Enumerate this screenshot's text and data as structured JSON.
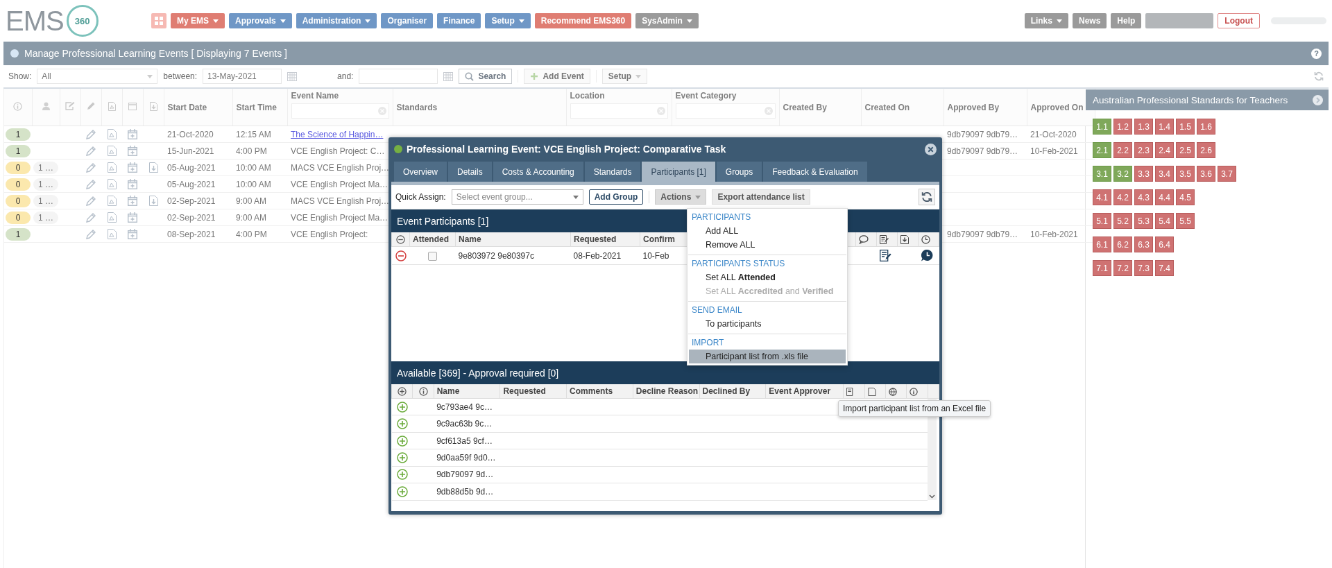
{
  "logo": {
    "wordmark": "EMS",
    "number": "360"
  },
  "nav": [
    {
      "label": "My EMS",
      "dropdown": true,
      "color": "#df7d72"
    },
    {
      "label": "Approvals",
      "dropdown": true,
      "color": "#6f97c6"
    },
    {
      "label": "Administration",
      "dropdown": true,
      "color": "#6f97c6"
    },
    {
      "label": "Organiser",
      "dropdown": false,
      "color": "#6f97c6"
    },
    {
      "label": "Finance",
      "dropdown": false,
      "color": "#6f97c6"
    },
    {
      "label": "Setup",
      "dropdown": true,
      "color": "#6f97c6"
    },
    {
      "label": "Recommend EMS360",
      "dropdown": false,
      "color": "#df7d72"
    },
    {
      "label": "SysAdmin",
      "dropdown": true,
      "color": "#9a9a9a"
    }
  ],
  "nav_right": [
    {
      "label": "Links",
      "dropdown": true,
      "kind": "plain"
    },
    {
      "label": "News",
      "dropdown": false,
      "kind": "plain"
    },
    {
      "label": "Help",
      "dropdown": false,
      "kind": "plain"
    },
    {
      "label": "Logout",
      "dropdown": false,
      "kind": "outline"
    }
  ],
  "help_glyph": "?",
  "page_title": "Manage Professional Learning Events [ Displaying 7 Events ]",
  "filters": {
    "show_label": "Show:",
    "show_value": "All",
    "between_label": "between:",
    "from_value": "13-May-2021",
    "and_label": "and:",
    "search_button": "Search",
    "add_button": "Add Event",
    "setup_button": "Setup"
  },
  "events": {
    "columns": [
      {
        "label": "Start Date",
        "filter": false
      },
      {
        "label": "Start Time",
        "filter": false
      },
      {
        "label": "Event Name",
        "filter": true
      },
      {
        "label": "Standards",
        "filter": false
      },
      {
        "label": "Location",
        "filter": true
      },
      {
        "label": "Event Category",
        "filter": true
      },
      {
        "label": "Created By",
        "filter": false
      },
      {
        "label": "Created On",
        "filter": false
      },
      {
        "label": "Approved By",
        "filter": false
      },
      {
        "label": "Approved On",
        "filter": false
      }
    ],
    "rows": [
      {
        "badge": "1",
        "color": "#d5e3c8",
        "person_count": "",
        "download": false,
        "start_date": "21-Oct-2020",
        "start_time": "12:15 AM",
        "event_name": "The Science of Happin…",
        "link": true,
        "approved_by": "9db79097 9db79…",
        "approved_on": "21-Oct-2020"
      },
      {
        "badge": "1",
        "color": "#d5e3c8",
        "person_count": "",
        "download": false,
        "start_date": "15-Jun-2021",
        "start_time": "4:00 PM",
        "event_name": "VCE English Project: C…",
        "link": false,
        "approved_by": "9db79097 9db79…",
        "approved_on": "10-Feb-2021"
      },
      {
        "badge": "0",
        "color": "#fbe8ad",
        "person_count": "1 …",
        "download": true,
        "start_date": "05-Aug-2021",
        "start_time": "10:00 AM",
        "event_name": "MACS VCE English Proj…",
        "link": false,
        "approved_by": "",
        "approved_on": ""
      },
      {
        "badge": "0",
        "color": "#fbe8ad",
        "person_count": "1 …",
        "download": false,
        "start_date": "05-Aug-2021",
        "start_time": "10:00 AM",
        "event_name": "VCE English Project Ma…",
        "link": false,
        "approved_by": "",
        "approved_on": ""
      },
      {
        "badge": "0",
        "color": "#fbe8ad",
        "person_count": "1 …",
        "download": true,
        "start_date": "02-Sep-2021",
        "start_time": "9:00 AM",
        "event_name": "MACS VCE English Proj…",
        "link": false,
        "approved_by": "",
        "approved_on": ""
      },
      {
        "badge": "0",
        "color": "#fbe8ad",
        "person_count": "1 …",
        "download": false,
        "start_date": "02-Sep-2021",
        "start_time": "9:00 AM",
        "event_name": "VCE English Project Ma…",
        "link": false,
        "approved_by": "",
        "approved_on": ""
      },
      {
        "badge": "1",
        "color": "#d5e3c8",
        "person_count": "",
        "download": false,
        "start_date": "08-Sep-2021",
        "start_time": "4:00 PM",
        "event_name": "VCE English Project:",
        "link": false,
        "approved_by": "9db79097 9db79…",
        "approved_on": "10-Feb-2021"
      }
    ]
  },
  "standards_panel": {
    "title": "Australian Professional Standards for Teachers",
    "groups": [
      [
        {
          "label": "1.1",
          "met": true
        },
        {
          "label": "1.2",
          "met": false
        },
        {
          "label": "1.3",
          "met": false
        },
        {
          "label": "1.4",
          "met": false
        },
        {
          "label": "1.5",
          "met": false
        },
        {
          "label": "1.6",
          "met": false
        }
      ],
      [
        {
          "label": "2.1",
          "met": true
        },
        {
          "label": "2.2",
          "met": false
        },
        {
          "label": "2.3",
          "met": false
        },
        {
          "label": "2.4",
          "met": false
        },
        {
          "label": "2.5",
          "met": false
        },
        {
          "label": "2.6",
          "met": false
        }
      ],
      [
        {
          "label": "3.1",
          "met": true
        },
        {
          "label": "3.2",
          "met": true
        },
        {
          "label": "3.3",
          "met": false
        },
        {
          "label": "3.4",
          "met": false
        },
        {
          "label": "3.5",
          "met": false
        },
        {
          "label": "3.6",
          "met": false
        },
        {
          "label": "3.7",
          "met": false
        }
      ],
      [
        {
          "label": "4.1",
          "met": false
        },
        {
          "label": "4.2",
          "met": false
        },
        {
          "label": "4.3",
          "met": false
        },
        {
          "label": "4.4",
          "met": false
        },
        {
          "label": "4.5",
          "met": false
        }
      ],
      [
        {
          "label": "5.1",
          "met": false
        },
        {
          "label": "5.2",
          "met": false
        },
        {
          "label": "5.3",
          "met": false
        },
        {
          "label": "5.4",
          "met": false
        },
        {
          "label": "5.5",
          "met": false
        }
      ],
      [
        {
          "label": "6.1",
          "met": false
        },
        {
          "label": "6.2",
          "met": false
        },
        {
          "label": "6.3",
          "met": false
        },
        {
          "label": "6.4",
          "met": false
        }
      ],
      [
        {
          "label": "7.1",
          "met": false
        },
        {
          "label": "7.2",
          "met": false
        },
        {
          "label": "7.3",
          "met": false
        },
        {
          "label": "7.4",
          "met": false
        }
      ]
    ]
  },
  "modal": {
    "title": "Professional Learning Event: VCE English Project: Comparative Task",
    "tabs": [
      {
        "label": "Overview",
        "selected": false
      },
      {
        "label": "Details",
        "selected": false
      },
      {
        "label": "Costs & Accounting",
        "selected": false
      },
      {
        "label": "Standards",
        "selected": false
      },
      {
        "label": "Participants [1]",
        "selected": true
      },
      {
        "label": "Groups",
        "selected": false
      },
      {
        "label": "Feedback & Evaluation",
        "selected": false
      }
    ],
    "quick_assign_label": "Quick Assign:",
    "quick_assign": {
      "placeholder": "Select event group..."
    },
    "add_group_button": "Add Group",
    "actions_button": "Actions",
    "export_button": "Export attendance list",
    "participants": {
      "title": "Event Participants [1]",
      "columns": [
        "Attended",
        "Name",
        "Requested",
        "Confirm"
      ],
      "rows": [
        {
          "attended": false,
          "name": "9e803972 9e80397c",
          "requested": "08-Feb-2021",
          "confirmed": "10-Feb"
        }
      ]
    },
    "available": {
      "title": "Available [369] - Approval required [0]",
      "columns": [
        "Name",
        "Requested",
        "Comments",
        "Decline Reason",
        "Declined By",
        "Event Approver"
      ],
      "rows": [
        "9c793ae4 9c…",
        "9c9ac63b 9c…",
        "9cf613a5 9cf…",
        "9d0aa59f 9d0…",
        "9db79097 9d…",
        "9db88d5b 9d…"
      ]
    },
    "actions_menu": [
      {
        "heading": "PARTICIPANTS",
        "items": [
          {
            "label": "Add ALL",
            "disabled": false,
            "highlighted": false
          },
          {
            "label": "Remove ALL",
            "disabled": false,
            "highlighted": false
          }
        ]
      },
      {
        "heading": "PARTICIPANTS STATUS",
        "items": [
          {
            "label": "Set ALL **Attended**",
            "disabled": false,
            "highlighted": false
          },
          {
            "label": "Set ALL **Accredited** and **Verified**",
            "disabled": true,
            "highlighted": false
          }
        ]
      },
      {
        "heading": "SEND EMAIL",
        "items": [
          {
            "label": "To participants",
            "disabled": false,
            "highlighted": false
          }
        ]
      },
      {
        "heading": "IMPORT",
        "items": [
          {
            "label": "Participant list from .xls file",
            "disabled": false,
            "highlighted": true
          }
        ]
      }
    ],
    "tooltip": "Import participant list from an Excel file"
  }
}
